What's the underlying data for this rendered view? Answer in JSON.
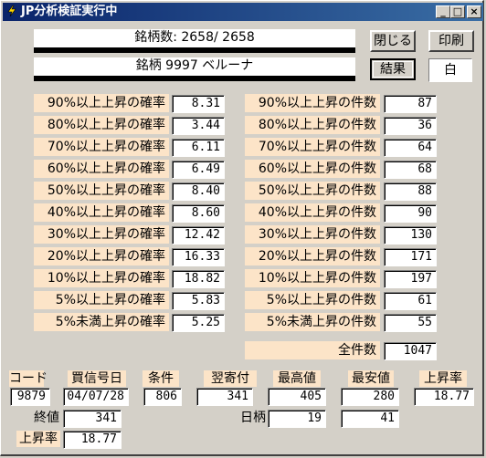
{
  "window": {
    "title": "JP分析検証実行中",
    "controls": {
      "minimize": "_",
      "maximize": "□",
      "close": "×"
    }
  },
  "progress": {
    "count_text": "銘柄数: 2658/ 2658",
    "count_fraction": 1.0,
    "stock_text": "銘柄 9997 ベルーナ",
    "stock_fraction": 1.0
  },
  "buttons": {
    "close": "閉じる",
    "print": "印刷",
    "result": "結果"
  },
  "color_box": "白",
  "prob_rows": [
    {
      "label": "90%以上上昇の確率",
      "value": "8.31"
    },
    {
      "label": "80%以上上昇の確率",
      "value": "3.44"
    },
    {
      "label": "70%以上上昇の確率",
      "value": "6.11"
    },
    {
      "label": "60%以上上昇の確率",
      "value": "6.49"
    },
    {
      "label": "50%以上上昇の確率",
      "value": "8.40"
    },
    {
      "label": "40%以上上昇の確率",
      "value": "8.60"
    },
    {
      "label": "30%以上上昇の確率",
      "value": "12.42"
    },
    {
      "label": "20%以上上昇の確率",
      "value": "16.33"
    },
    {
      "label": "10%以上上昇の確率",
      "value": "18.82"
    },
    {
      "label": "5%以上上昇の確率",
      "value": "5.83"
    },
    {
      "label": "5%未満上昇の確率",
      "value": "5.25"
    }
  ],
  "count_rows": [
    {
      "label": "90%以上上昇の件数",
      "value": "87"
    },
    {
      "label": "80%以上上昇の件数",
      "value": "36"
    },
    {
      "label": "70%以上上昇の件数",
      "value": "64"
    },
    {
      "label": "60%以上上昇の件数",
      "value": "68"
    },
    {
      "label": "50%以上上昇の件数",
      "value": "88"
    },
    {
      "label": "40%以上上昇の件数",
      "value": "90"
    },
    {
      "label": "30%以上上昇の件数",
      "value": "130"
    },
    {
      "label": "20%以上上昇の件数",
      "value": "171"
    },
    {
      "label": "10%以上上昇の件数",
      "value": "197"
    },
    {
      "label": "5%以上上昇の件数",
      "value": "61"
    },
    {
      "label": "5%未満上昇の件数",
      "value": "55"
    }
  ],
  "total": {
    "label": "全件数",
    "value": "1047"
  },
  "detail": {
    "code_label": "コード",
    "code": "9879",
    "buy_date_label": "買信号日",
    "buy_date": "04/07/28",
    "condition_label": "条件",
    "condition": "806",
    "next_open_label": "翌寄付",
    "next_open": "341",
    "high_label": "最高値",
    "high": "405",
    "low_label": "最安値",
    "low": "280",
    "rise_label": "上昇率",
    "rise": "18.77",
    "close_label": "終値",
    "close": "341",
    "days_label": "日柄",
    "days": "19",
    "days_low": "41",
    "rise2_label": "上昇率",
    "rise2": "18.77"
  }
}
